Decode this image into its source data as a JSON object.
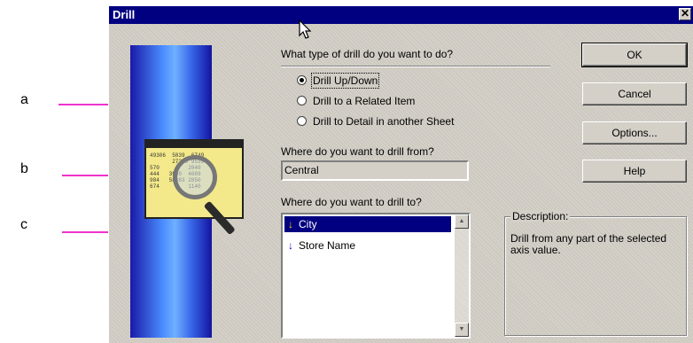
{
  "callouts": {
    "a": "a",
    "b": "b",
    "c": "c"
  },
  "dialog": {
    "title": "Drill",
    "close_glyph": "✕",
    "question_type": "What type of drill do you want to do?",
    "drill_types": [
      {
        "label": "Drill Up/Down",
        "checked": true
      },
      {
        "label": "Drill to a Related Item",
        "checked": false
      },
      {
        "label": "Drill to Detail in another Sheet",
        "checked": false
      }
    ],
    "from_label": "Where do you want to drill from?",
    "from_value": "Central",
    "to_label": "Where do you want to drill to?",
    "to_items": [
      {
        "label": "City",
        "icon": "arrow-down-icon",
        "selected": true
      },
      {
        "label": "Store Name",
        "icon": "arrow-down-icon",
        "selected": false
      }
    ],
    "description_title": "Description:",
    "description_text": "Drill from any part of the selected axis value.",
    "buttons": {
      "ok": "OK",
      "cancel": "Cancel",
      "options": "Options...",
      "help": "Help"
    }
  },
  "art": {
    "sheet_numbers": "49306  5839  6749\n       27283 95394\n570         2040\n444   3950  4689\n984   58483 2850\n674         1140"
  },
  "colors": {
    "titlebar": "#000080",
    "callout_line": "#ee33cc",
    "selection": "#000080"
  }
}
